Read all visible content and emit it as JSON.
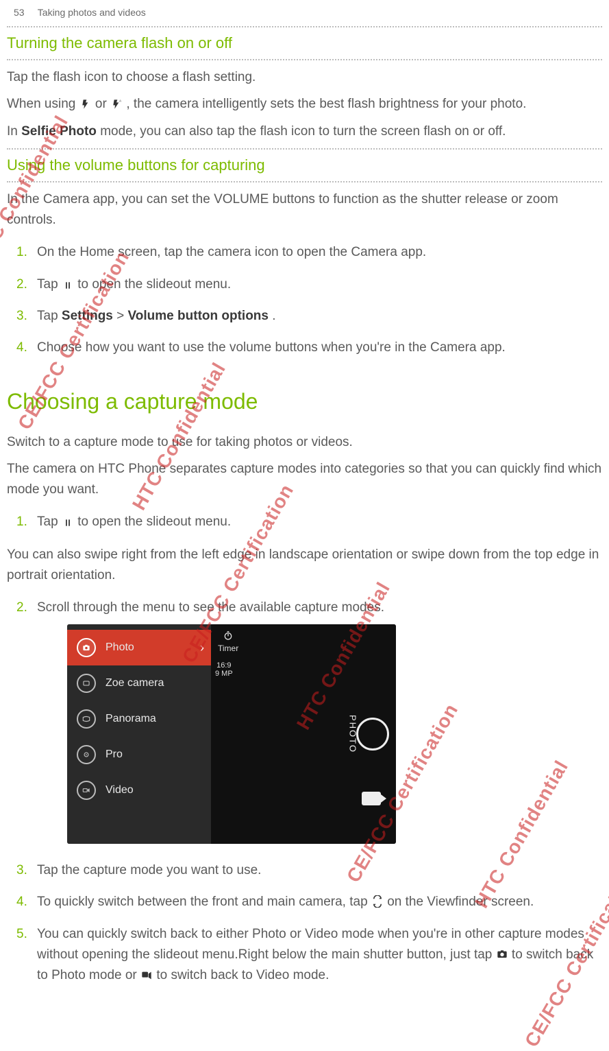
{
  "header": {
    "page_num": "53",
    "crumb": "Taking photos and videos"
  },
  "sec1": {
    "title": "Turning the camera flash on or off",
    "p1": "Tap the flash icon to choose a flash setting.",
    "p2_a": "When using ",
    "p2_b": " or ",
    "p2_c": ", the camera intelligently sets the best flash brightness for your photo.",
    "p3_a": "In ",
    "p3_bold": "Selfie Photo",
    "p3_b": " mode, you can also tap the flash icon to turn the screen flash on or off."
  },
  "sec2": {
    "title": "Using the volume buttons for capturing",
    "p1": "In the Camera app, you can set the VOLUME buttons to function as the shutter release or zoom controls.",
    "steps": {
      "s1": "On the Home screen, tap the camera icon to open the Camera app.",
      "s2_a": "Tap ",
      "s2_b": " to open the slideout menu.",
      "s3_a": "Tap ",
      "s3_bold1": "Settings",
      "s3_mid": " > ",
      "s3_bold2": "Volume button options",
      "s3_end": ".",
      "s4": "Choose how you want to use the volume buttons when you're in the Camera app."
    }
  },
  "sec3": {
    "title": "Choosing a capture mode",
    "p1": "Switch to a capture mode to use for taking photos or videos.",
    "p2": " The camera on HTC Phone separates capture modes into categories so that you can quickly find which mode you want.",
    "s1_a": "Tap ",
    "s1_b": " to open the slideout menu.",
    "p3": " You can also swipe right from the left edge in landscape orientation or swipe down from the top edge in portrait orientation.",
    "s2": "Scroll through the menu to see the available capture modes.",
    "s3": "Tap the capture mode you want to use.",
    "s4_a": "To quickly switch between the front and main camera, tap ",
    "s4_b": " on the Viewfinder screen.",
    "s5_a": "You can quickly switch back to either Photo or Video mode when you're in other capture modes without opening the slideout menu.Right below the main shutter button, just tap ",
    "s5_b": " to switch back to Photo mode or ",
    "s5_c": " to switch back to Video mode."
  },
  "ss": {
    "items": [
      "Photo",
      "Zoe camera",
      "Panorama",
      "Pro",
      "Video"
    ],
    "timer": "Timer",
    "ratio_top": "16:9",
    "ratio_bot": "9 MP",
    "photo_label": "PHOTO"
  },
  "wm": {
    "a": "HTC Confidential",
    "b": "CE/FCC Certification"
  }
}
